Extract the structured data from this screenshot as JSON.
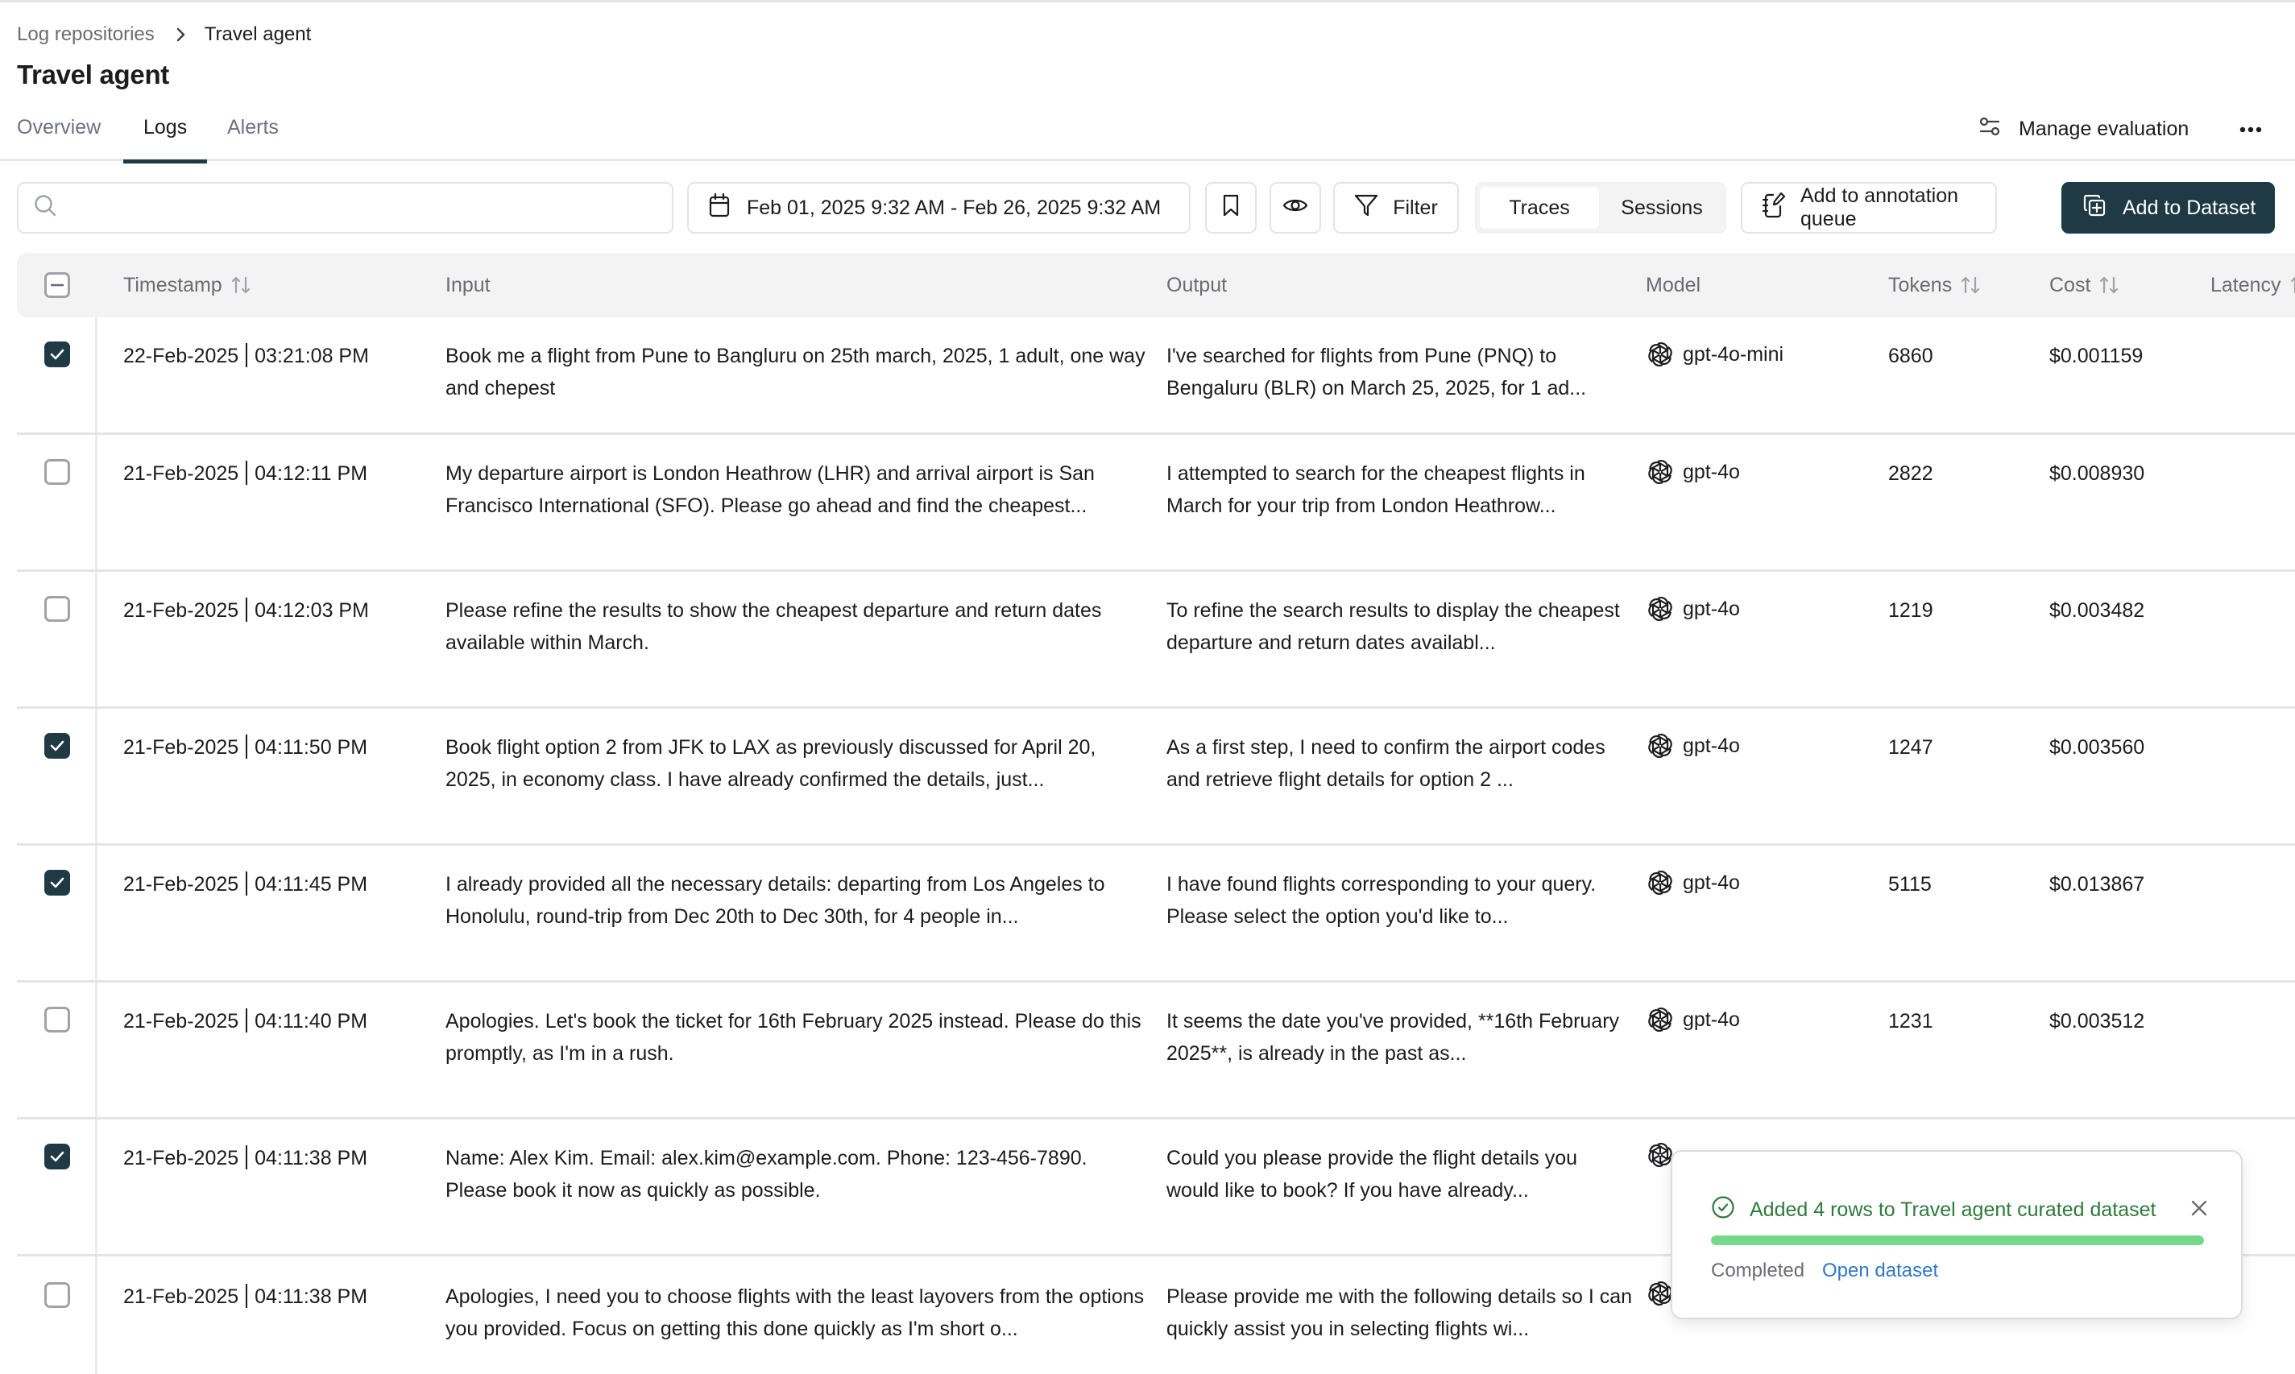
{
  "breadcrumb": {
    "parent": "Log repositories",
    "current": "Travel agent"
  },
  "page_title": "Travel agent",
  "tabs": [
    {
      "label": "Overview",
      "active": false
    },
    {
      "label": "Logs",
      "active": true
    },
    {
      "label": "Alerts",
      "active": false
    }
  ],
  "header_actions": {
    "manage_evaluation": "Manage evaluation",
    "more_icon": "more-horizontal-icon"
  },
  "toolbar": {
    "search": {
      "value": "",
      "placeholder": ""
    },
    "date_range": "Feb 01, 2025 9:32 AM - Feb 26, 2025 9:32 AM",
    "filter_label": "Filter",
    "view_toggle": [
      {
        "label": "Traces",
        "active": true
      },
      {
        "label": "Sessions",
        "active": false
      }
    ],
    "annotation_label": "Add to annotation queue",
    "dataset_label": "Add to Dataset"
  },
  "table": {
    "columns": [
      {
        "label": "Timestamp",
        "sortable": true
      },
      {
        "label": "Input",
        "sortable": false
      },
      {
        "label": "Output",
        "sortable": false
      },
      {
        "label": "Model",
        "sortable": false
      },
      {
        "label": "Tokens",
        "sortable": true
      },
      {
        "label": "Cost",
        "sortable": true
      },
      {
        "label": "Latency",
        "sortable": true
      }
    ],
    "select_all_state": "indeterminate",
    "rows": [
      {
        "checked": true,
        "date": "22-Feb-2025",
        "time": "03:21:08 PM",
        "input": "Book me a flight from Pune to Bangluru on 25th march, 2025, 1 adult, one way and chepest",
        "output": "I've searched for flights from Pune (PNQ) to Bengaluru (BLR) on March 25, 2025, for 1 ad...",
        "model": "gpt-4o-mini",
        "tokens": "6860",
        "cost": "$0.001159"
      },
      {
        "checked": false,
        "date": "21-Feb-2025",
        "time": "04:12:11 PM",
        "input": "My departure airport is London Heathrow (LHR) and arrival airport is San Francisco International (SFO). Please go ahead and find the cheapest...",
        "output": "I attempted to search for the cheapest flights in March for your trip from London Heathrow...",
        "model": "gpt-4o",
        "tokens": "2822",
        "cost": "$0.008930"
      },
      {
        "checked": false,
        "date": "21-Feb-2025",
        "time": "04:12:03 PM",
        "input": "Please refine the results to show the cheapest departure and return dates available within March.",
        "output": "To refine the search results to display the cheapest departure and return dates availabl...",
        "model": "gpt-4o",
        "tokens": "1219",
        "cost": "$0.003482"
      },
      {
        "checked": true,
        "date": "21-Feb-2025",
        "time": "04:11:50 PM",
        "input": "Book flight option 2 from JFK to LAX as previously discussed for April 20, 2025, in economy class. I have already confirmed the details, just...",
        "output": "As a first step, I need to confirm the airport codes and retrieve flight details for option 2 ...",
        "model": "gpt-4o",
        "tokens": "1247",
        "cost": "$0.003560"
      },
      {
        "checked": true,
        "date": "21-Feb-2025",
        "time": "04:11:45 PM",
        "input": "I already provided all the necessary details: departing from Los Angeles to Honolulu, round-trip from Dec 20th to Dec 30th, for 4 people in...",
        "output": "I have found flights corresponding to your query. Please select the option you'd like to...",
        "model": "gpt-4o",
        "tokens": "5115",
        "cost": "$0.013867"
      },
      {
        "checked": false,
        "date": "21-Feb-2025",
        "time": "04:11:40 PM",
        "input": "Apologies. Let's book the ticket for 16th February 2025 instead. Please do this promptly, as I'm in a rush.",
        "output": "It seems the date you've provided, **16th February 2025**, is already in the past as...",
        "model": "gpt-4o",
        "tokens": "1231",
        "cost": "$0.003512"
      },
      {
        "checked": true,
        "date": "21-Feb-2025",
        "time": "04:11:38 PM",
        "input": "Name: Alex Kim. Email: alex.kim@example.com. Phone: 123-456-7890. Please book it now as quickly as possible.",
        "output": "Could you please provide the flight details you would like to book? If you have already...",
        "model": "",
        "tokens": "",
        "cost": ""
      },
      {
        "checked": false,
        "date": "21-Feb-2025",
        "time": "04:11:38 PM",
        "input": "Apologies, I need you to choose flights with the least layovers from the options you provided. Focus on getting this done quickly as I'm short o...",
        "output": "Please provide me with the following details so I can quickly assist you in selecting flights wi...",
        "model": "",
        "tokens": "",
        "cost": ""
      }
    ]
  },
  "toast": {
    "message": "Added 4 rows to Travel agent curated dataset",
    "progress_percent": 100,
    "status": "Completed",
    "link": "Open dataset",
    "colors": {
      "success": "#2f7a3c",
      "progress": "#76d88a",
      "link": "#2f78c4"
    }
  },
  "colors": {
    "accent": "#1f3a44",
    "muted_text": "#6b6b73",
    "border": "#e4e4e7",
    "header_bg": "#f3f3f4"
  }
}
